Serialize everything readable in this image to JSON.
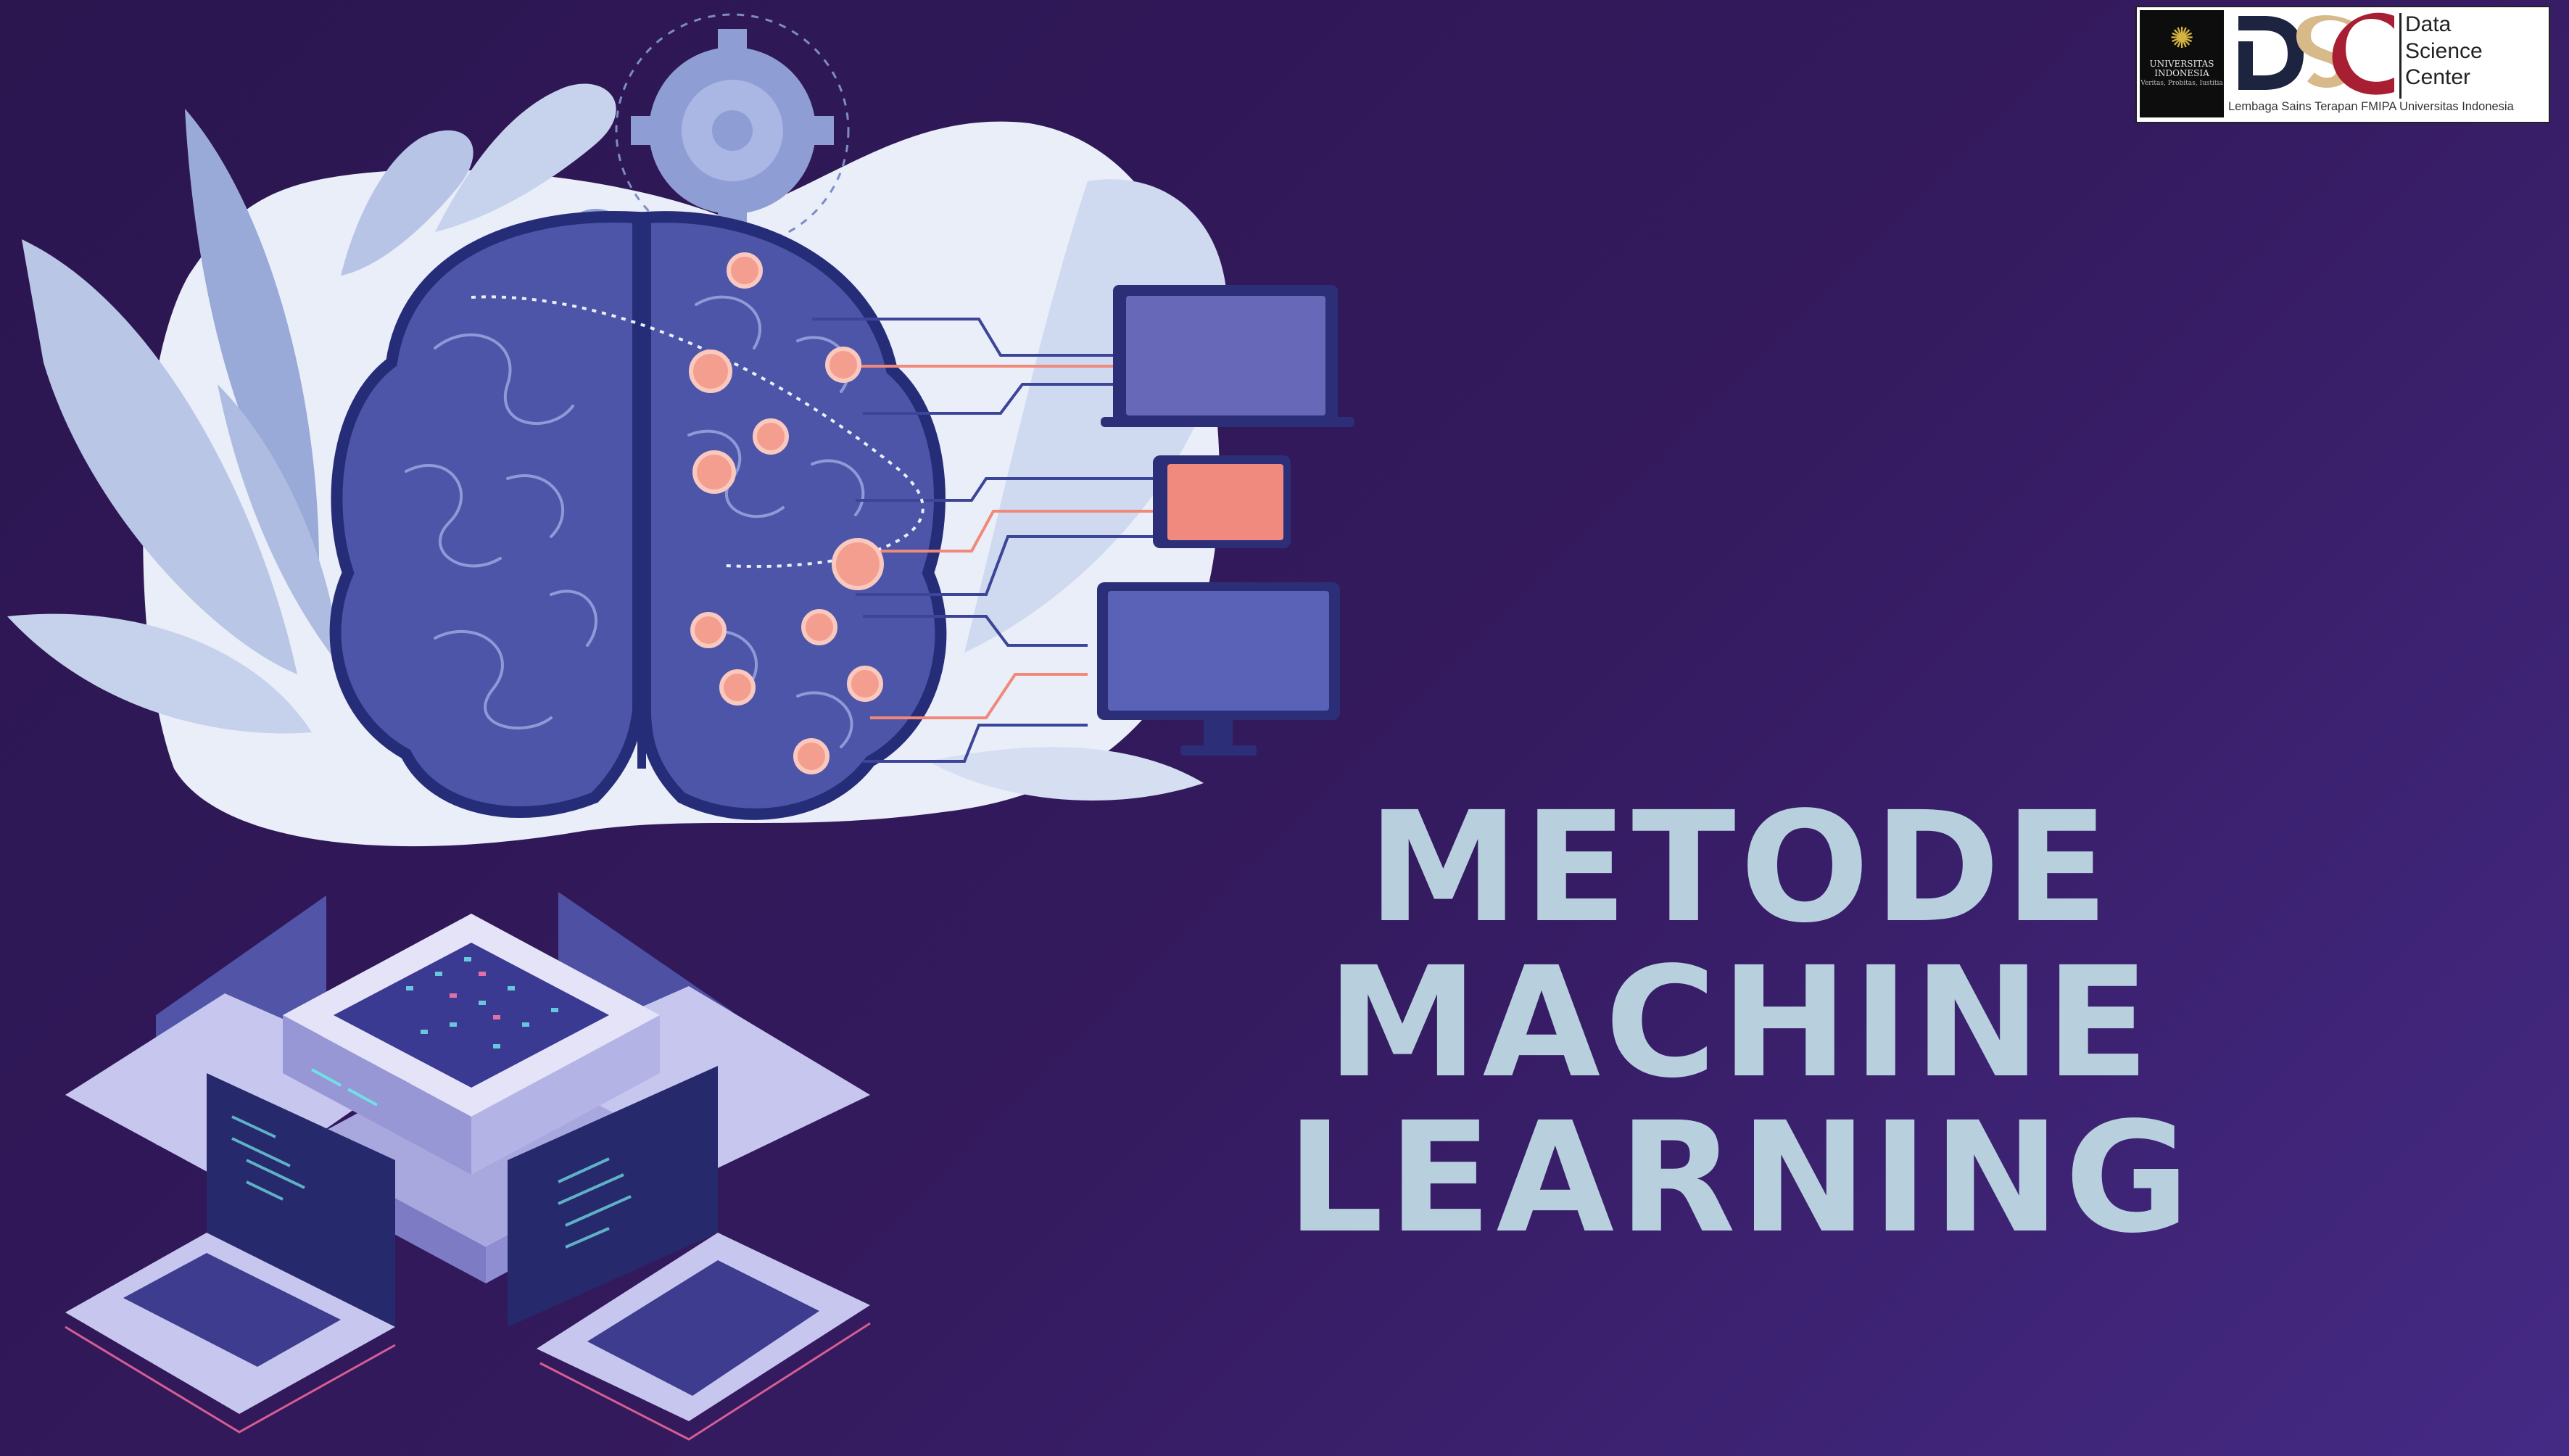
{
  "slide": {
    "title_line1": "METODE",
    "title_line2": "MACHINE LEARNING"
  },
  "logo": {
    "university_name_line1": "UNIVERSITAS",
    "university_name_line2": "INDONESIA",
    "university_motto": "Veritas, Probitas, Iustitia",
    "dsc_letters": "DSC",
    "org_name_line1": "Data",
    "org_name_line2": "Science",
    "org_name_line3": "Center",
    "org_subtitle": "Lembaga Sains Terapan FMIPA Universitas Indonesia"
  },
  "icons": {
    "brain": "brain-illustration",
    "gears": "gear-icon",
    "devices": [
      "laptop-icon",
      "tablet-icon",
      "monitor-icon"
    ],
    "server": "isometric-server-illustration"
  },
  "colors": {
    "background_start": "#2b1650",
    "background_end": "#452a85",
    "title_text": "#b8d0de",
    "brain_fill": "#4d55a8",
    "node_coral": "#f49e8f",
    "leaf_light": "#c6d2ec",
    "dsc_dark": "#1c2440",
    "dsc_gold": "#d7b98a",
    "dsc_crimson": "#a81e33"
  }
}
